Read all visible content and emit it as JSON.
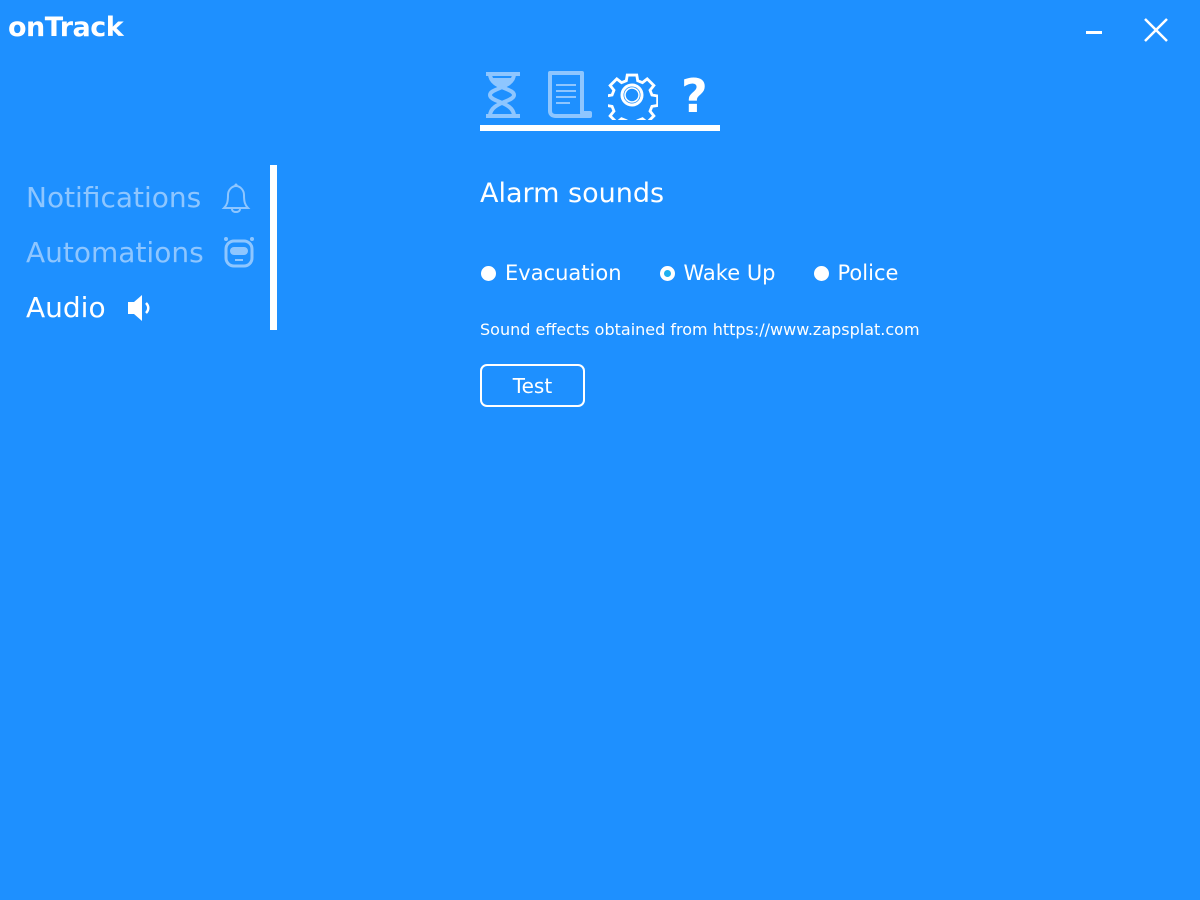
{
  "app": {
    "title": "onTrack"
  },
  "topnav": [
    "timer",
    "log",
    "settings",
    "help"
  ],
  "sidebar": {
    "items": [
      {
        "label": "Notifications"
      },
      {
        "label": "Automations"
      },
      {
        "label": "Audio"
      }
    ]
  },
  "main": {
    "heading": "Alarm sounds",
    "options": [
      {
        "label": "Evacuation",
        "selected": false
      },
      {
        "label": "Wake Up",
        "selected": true
      },
      {
        "label": "Police",
        "selected": false
      }
    ],
    "credit": "Sound effects obtained from https://www.zapsplat.com",
    "test_label": "Test"
  },
  "colors": {
    "background": "#1e90ff",
    "inactive": "#8ec6ff",
    "text": "#ffffff"
  }
}
